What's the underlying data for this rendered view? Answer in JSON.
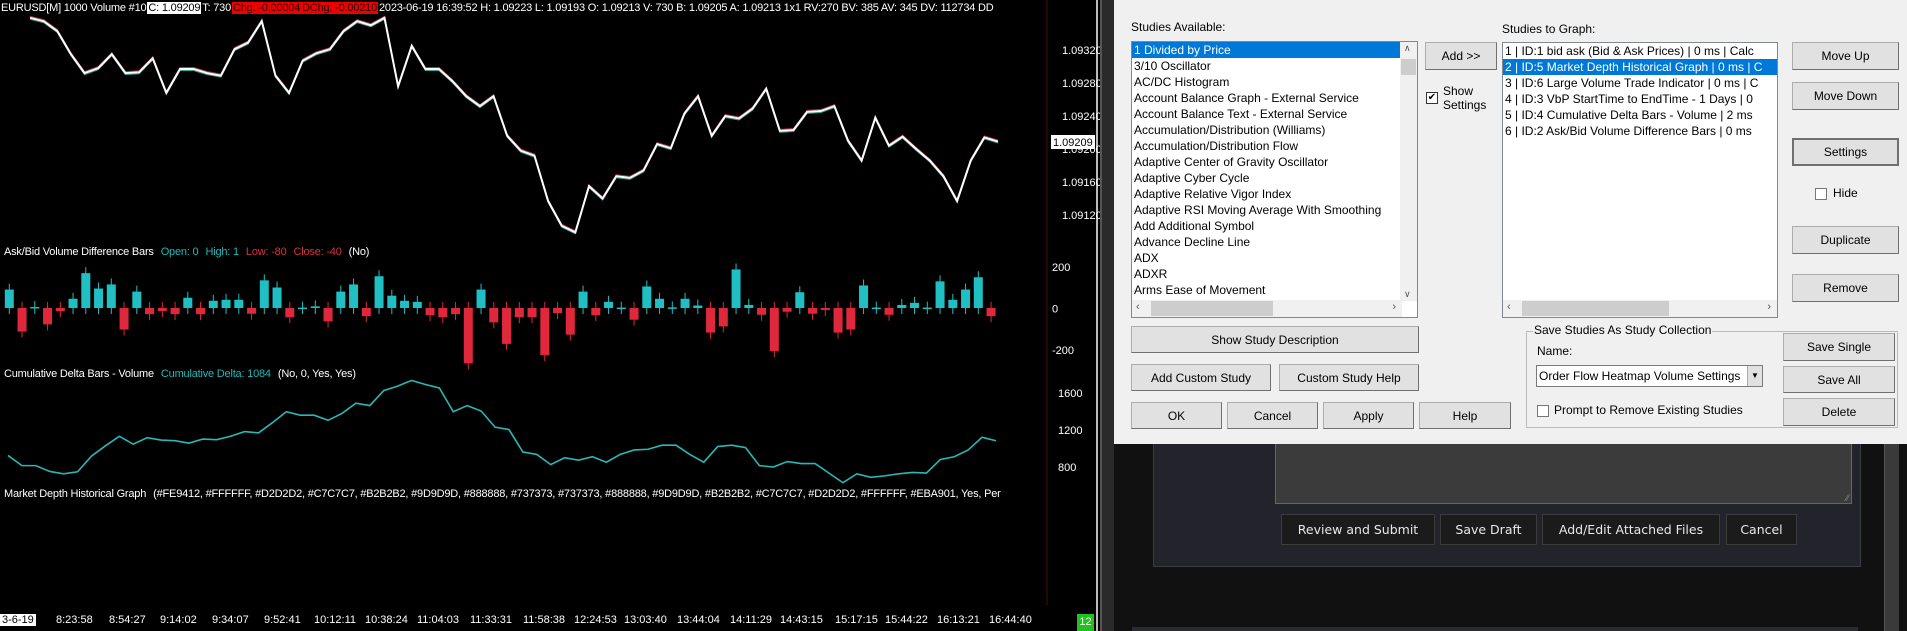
{
  "chart_header": {
    "symbol": "EURUSD[M]  1000 Volume #10",
    "close": "C: 1.09209",
    "ticks": "T: 730",
    "chg": "Chg: -0.00004",
    "dchg": "DChg: -0.00210",
    "rest": "2023-06-19 16:39:52 H: 1.09223 L: 1.09193 O: 1.09213 V: 730 B: 1.09205 A: 1.09213 1x1 RV:270 BV: 385 AV: 345 DV: 112734 DD"
  },
  "study_labels": {
    "askbid": {
      "name": "Ask/Bid Volume Difference Bars",
      "open": "Open: 0",
      "high": "High: 1",
      "low": "Low: -80",
      "close": "Close: -40",
      "params": "(No)"
    },
    "cumdelta": {
      "name": "Cumulative Delta Bars - Volume",
      "value": "Cumulative Delta: 1084",
      "params": "(No, 0, Yes, Yes)"
    },
    "mdhg": {
      "name": "Market Depth Historical Graph",
      "params": "(#FE9412, #FFFFFF, #D2D2D2, #C7C7C7, #B2B2B2, #9D9D9D, #888888, #737373, #737373, #888888, #9D9D9D, #B2B2B2, #C7C7C7, #D2D2D2, #FFFFFF, #EBA901, Yes, Per"
    }
  },
  "chart_data": [
    {
      "type": "line",
      "title": "EURUSD[M] price",
      "ylim": [
        1.0912,
        1.0932
      ],
      "yticks": [
        "1.09320",
        "1.09280",
        "1.09240",
        "1.09200",
        "1.09160",
        "1.09120"
      ],
      "current_price_label": "1.09209",
      "values": [
        1.09359,
        1.09355,
        1.09343,
        1.09315,
        1.09292,
        1.09298,
        1.09315,
        1.09292,
        1.09293,
        1.0931,
        1.09268,
        1.09297,
        1.09297,
        1.09292,
        1.09289,
        1.09321,
        1.09329,
        1.09355,
        1.09289,
        1.09268,
        1.09307,
        1.09316,
        1.09321,
        1.09343,
        1.09355,
        1.0935,
        1.09359,
        1.09276,
        1.09325,
        1.09297,
        1.09297,
        1.09282,
        1.09264,
        1.09252,
        1.09264,
        1.09216,
        1.09198,
        1.09192,
        1.09137,
        1.09107,
        1.09099,
        1.09155,
        1.0914,
        1.09167,
        1.09165,
        1.09174,
        1.09206,
        1.09201,
        1.09243,
        1.09264,
        1.09216,
        1.0924,
        1.09237,
        1.09249,
        1.09273,
        1.09222,
        1.09223,
        1.09245,
        1.09246,
        1.09252,
        1.0921,
        1.09186,
        1.09238,
        1.09204,
        1.09215,
        1.092,
        1.09186,
        1.09167,
        1.09137,
        1.09186,
        1.09214,
        1.09209
      ]
    },
    {
      "type": "bar",
      "title": "Ask/Bid Volume Difference Bars",
      "ylim": [
        -200,
        200
      ],
      "yticks": [
        "200",
        "0",
        "-200"
      ],
      "values": [
        90,
        -115,
        5,
        -80,
        -15,
        45,
        170,
        95,
        115,
        -105,
        80,
        -30,
        -15,
        -30,
        50,
        -30,
        35,
        40,
        40,
        -28,
        135,
        100,
        -45,
        2,
        8,
        -65,
        80,
        115,
        -40,
        155,
        60,
        35,
        30,
        -35,
        -45,
        -30,
        -270,
        90,
        -70,
        -175,
        -45,
        -45,
        -230,
        -25,
        -130,
        80,
        -35,
        30,
        2,
        -57,
        105,
        45,
        3,
        45,
        12,
        -120,
        -90,
        188,
        15,
        -33,
        -210,
        -18,
        77,
        -28,
        -10,
        -120,
        -105,
        110,
        2,
        -33,
        15,
        25,
        2,
        130,
        40,
        90,
        150,
        -40
      ],
      "colors": {
        "up": "#20bfc4",
        "down": "#e0283c"
      }
    },
    {
      "type": "line",
      "title": "Cumulative Delta Bars - Volume",
      "ylim": [
        800,
        1600
      ],
      "yticks": [
        "1600",
        "1200",
        "800"
      ],
      "values": [
        925,
        815,
        815,
        752,
        726,
        748,
        918,
        1029,
        1132,
        1047,
        1117,
        1091,
        1084,
        1058,
        1102,
        1095,
        1132,
        1183,
        1169,
        1279,
        1397,
        1360,
        1360,
        1305,
        1379,
        1489,
        1464,
        1626,
        1674,
        1736,
        1692,
        1655,
        1397,
        1464,
        1405,
        1231,
        1205,
        962,
        936,
        826,
        900,
        874,
        911,
        852,
        936,
        984,
        992,
        1036,
        1036,
        936,
        852,
        1021,
        1036,
        1010,
        815,
        800,
        859,
        837,
        837,
        734,
        630,
        726,
        689,
        704,
        726,
        741,
        734,
        881,
        911,
        984,
        1121,
        1084
      ],
      "color": "#2ab7b7"
    }
  ],
  "time_axis": {
    "date_label": "3-6-19",
    "labels": [
      "8:23:58",
      "8:54:27",
      "9:14:02",
      "9:34:07",
      "9:52:41",
      "10:12:11",
      "10:38:24",
      "11:04:03",
      "11:33:31",
      "11:58:38",
      "12:24:53",
      "13:03:40",
      "13:44:04",
      "14:11:29",
      "14:43:15",
      "15:17:15",
      "15:44:22",
      "16:13:21",
      "16:44:40"
    ],
    "counter": "12"
  },
  "dialog": {
    "available_label": "Studies Available:",
    "available": [
      "1 Divided by Price",
      "3/10 Oscillator",
      "AC/DC Histogram",
      "Account Balance Graph - External Service",
      "Account Balance Text - External Service",
      "Accumulation/Distribution (Williams)",
      "Accumulation/Distribution Flow",
      "Adaptive Center of Gravity Oscillator",
      "Adaptive Cyber Cycle",
      "Adaptive Relative Vigor Index",
      "Adaptive RSI Moving Average With Smoothing",
      "Add Additional Symbol",
      "Advance Decline Line",
      "ADX",
      "ADXR",
      "Arms Ease of Movement"
    ],
    "add_button": "Add >>",
    "show_settings": "Show Settings",
    "graph_label": "Studies to Graph:",
    "graph": [
      "1 | ID:1  bid ask (Bid & Ask Prices) | 0 ms | Calc",
      "2 | ID:5  Market Depth Historical Graph | 0 ms | C",
      "3 | ID:6  Large Volume Trade Indicator | 0 ms | C",
      "4 | ID:3  VbP StartTime to EndTime - 1 Days | 0",
      "5 | ID:4  Cumulative Delta Bars - Volume | 2 ms",
      "6 | ID:2  Ask/Bid Volume Difference Bars | 0 ms"
    ],
    "move_up": "Move Up",
    "move_down": "Move Down",
    "settings": "Settings",
    "hide": "Hide",
    "duplicate": "Duplicate",
    "remove": "Remove",
    "show_desc": "Show Study Description",
    "add_custom": "Add Custom Study",
    "custom_help": "Custom Study Help",
    "ok": "OK",
    "cancel": "Cancel",
    "apply": "Apply",
    "help": "Help",
    "collection_title": "Save Studies As Study Collection",
    "name_label": "Name:",
    "name_value": "Order Flow Heatmap Volume Settings",
    "prompt_remove": "Prompt to Remove Existing Studies",
    "save_single": "Save Single",
    "save_all": "Save All",
    "delete": "Delete"
  },
  "forum": {
    "review": "Review and Submit",
    "save_draft": "Save Draft",
    "attach": "Add/Edit Attached Files",
    "cancel": "Cancel"
  }
}
